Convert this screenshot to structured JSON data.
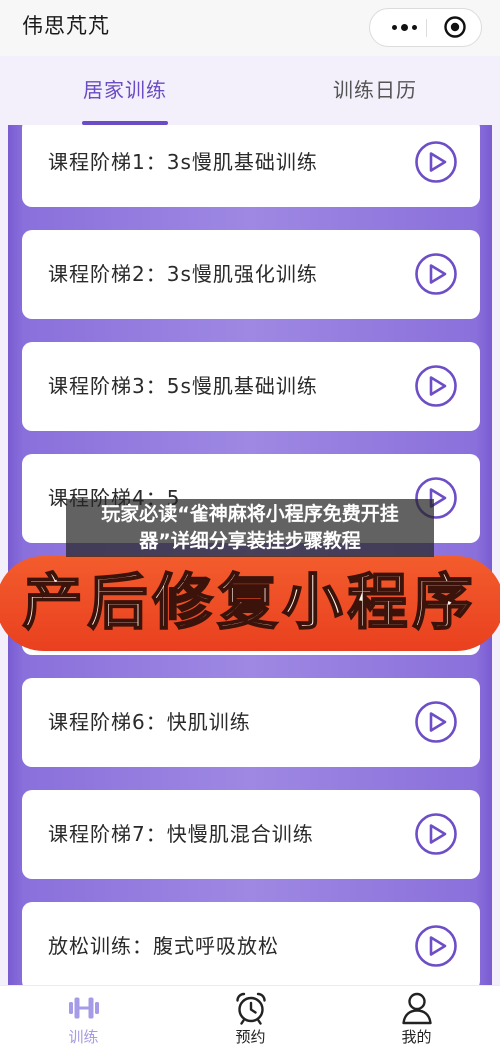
{
  "header": {
    "title": "伟思芃芃",
    "more_icon": "more-dots-icon",
    "close_icon": "target-icon"
  },
  "tabs": [
    {
      "label": "居家训练",
      "active": true
    },
    {
      "label": "训练日历",
      "active": false
    }
  ],
  "courses": [
    {
      "title": "课程阶梯1：3s慢肌基础训练",
      "icon": "play-icon"
    },
    {
      "title": "课程阶梯2：3s慢肌强化训练",
      "icon": "play-icon"
    },
    {
      "title": "课程阶梯3：5s慢肌基础训练",
      "icon": "play-icon"
    },
    {
      "title": "课程阶梯4：5",
      "icon": "play-icon"
    },
    {
      "title": ""
    },
    {
      "title": "课程阶梯6：快肌训练",
      "icon": "play-icon"
    },
    {
      "title": "课程阶梯7：快慢肌混合训练",
      "icon": "play-icon"
    },
    {
      "title": "放松训练：腹式呼吸放松",
      "icon": "play-icon"
    }
  ],
  "notice": {
    "line1": "玩家必读“雀神麻将小程序免费开挂",
    "line2": "器”详细分享装挂步骤教程"
  },
  "banner": {
    "text": "产后修复小程序"
  },
  "bottom_nav": [
    {
      "label": "训练",
      "icon": "dumbbell-icon",
      "active": true
    },
    {
      "label": "预约",
      "icon": "alarm-clock-icon",
      "active": false
    },
    {
      "label": "我的",
      "icon": "person-icon",
      "active": false
    }
  ],
  "colors": {
    "accent": "#6a4cc4",
    "board": "#8a70db",
    "banner": "#ee4a24",
    "nav_active": "#a59be6"
  }
}
